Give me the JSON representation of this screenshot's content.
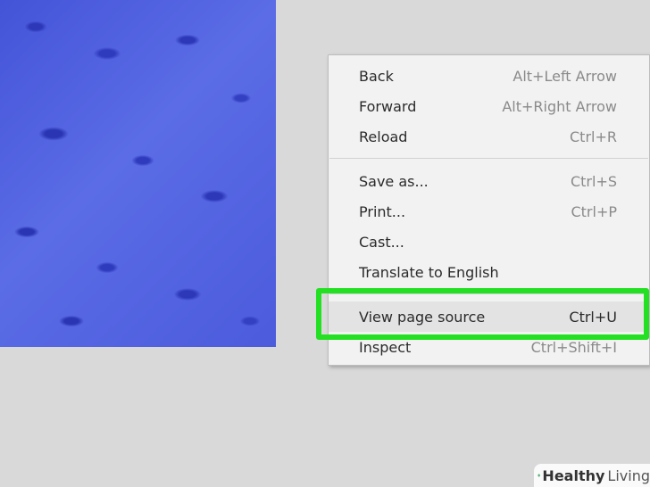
{
  "context_menu": {
    "items": [
      {
        "label": "Back",
        "shortcut": "Alt+Left Arrow"
      },
      {
        "label": "Forward",
        "shortcut": "Alt+Right Arrow"
      },
      {
        "label": "Reload",
        "shortcut": "Ctrl+R"
      },
      {
        "label": "Save as...",
        "shortcut": "Ctrl+S"
      },
      {
        "label": "Print...",
        "shortcut": "Ctrl+P"
      },
      {
        "label": "Cast...",
        "shortcut": ""
      },
      {
        "label": "Translate to English",
        "shortcut": ""
      },
      {
        "label": "View page source",
        "shortcut": "Ctrl+U"
      },
      {
        "label": "Inspect",
        "shortcut": "Ctrl+Shift+I"
      }
    ],
    "highlighted_item": "View page source"
  },
  "watermark": {
    "brand_bold": "Healthy",
    "brand_light": "Living"
  },
  "colors": {
    "highlight_border": "#23e023",
    "menu_background": "#f2f2f2",
    "image_blue": "#4b5bdc"
  }
}
